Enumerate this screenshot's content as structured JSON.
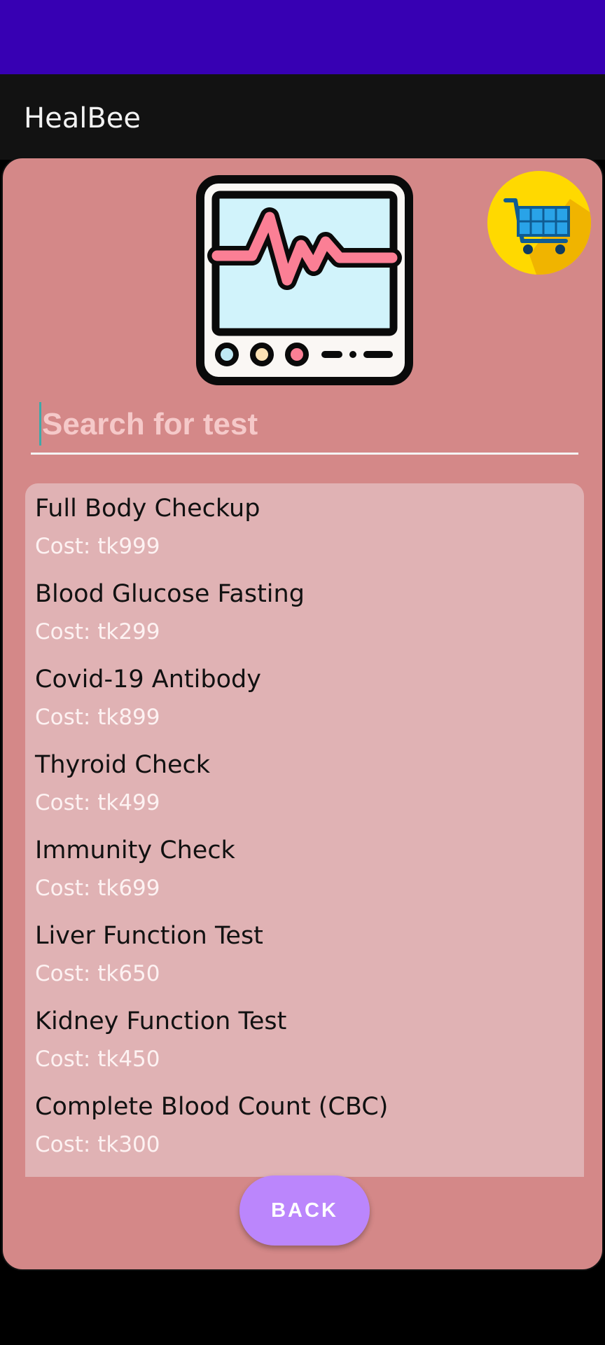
{
  "app": {
    "title": "HealBee"
  },
  "search": {
    "placeholder": "Search for test"
  },
  "tests": [
    {
      "name": "Full Body Checkup",
      "cost": "Cost: tk999"
    },
    {
      "name": "Blood Glucose Fasting",
      "cost": "Cost: tk299"
    },
    {
      "name": "Covid-19 Antibody",
      "cost": "Cost: tk899"
    },
    {
      "name": "Thyroid Check",
      "cost": "Cost: tk499"
    },
    {
      "name": "Immunity Check",
      "cost": "Cost: tk699"
    },
    {
      "name": "Liver Function Test",
      "cost": "Cost: tk650"
    },
    {
      "name": "Kidney Function Test",
      "cost": "Cost: tk450"
    },
    {
      "name": "Complete Blood Count (CBC)",
      "cost": "Cost: tk300"
    }
  ],
  "buttons": {
    "back_label": "BACK"
  },
  "colors": {
    "status_bar": "#3700b3",
    "app_bar": "#121212",
    "card_background": "#d48888",
    "list_background": "#e0b2b4",
    "back_button": "#bb86fc",
    "cart_circle": "#ffd900"
  },
  "icons": {
    "header_image": "heart-monitor-icon",
    "cart": "shopping-cart-icon"
  }
}
